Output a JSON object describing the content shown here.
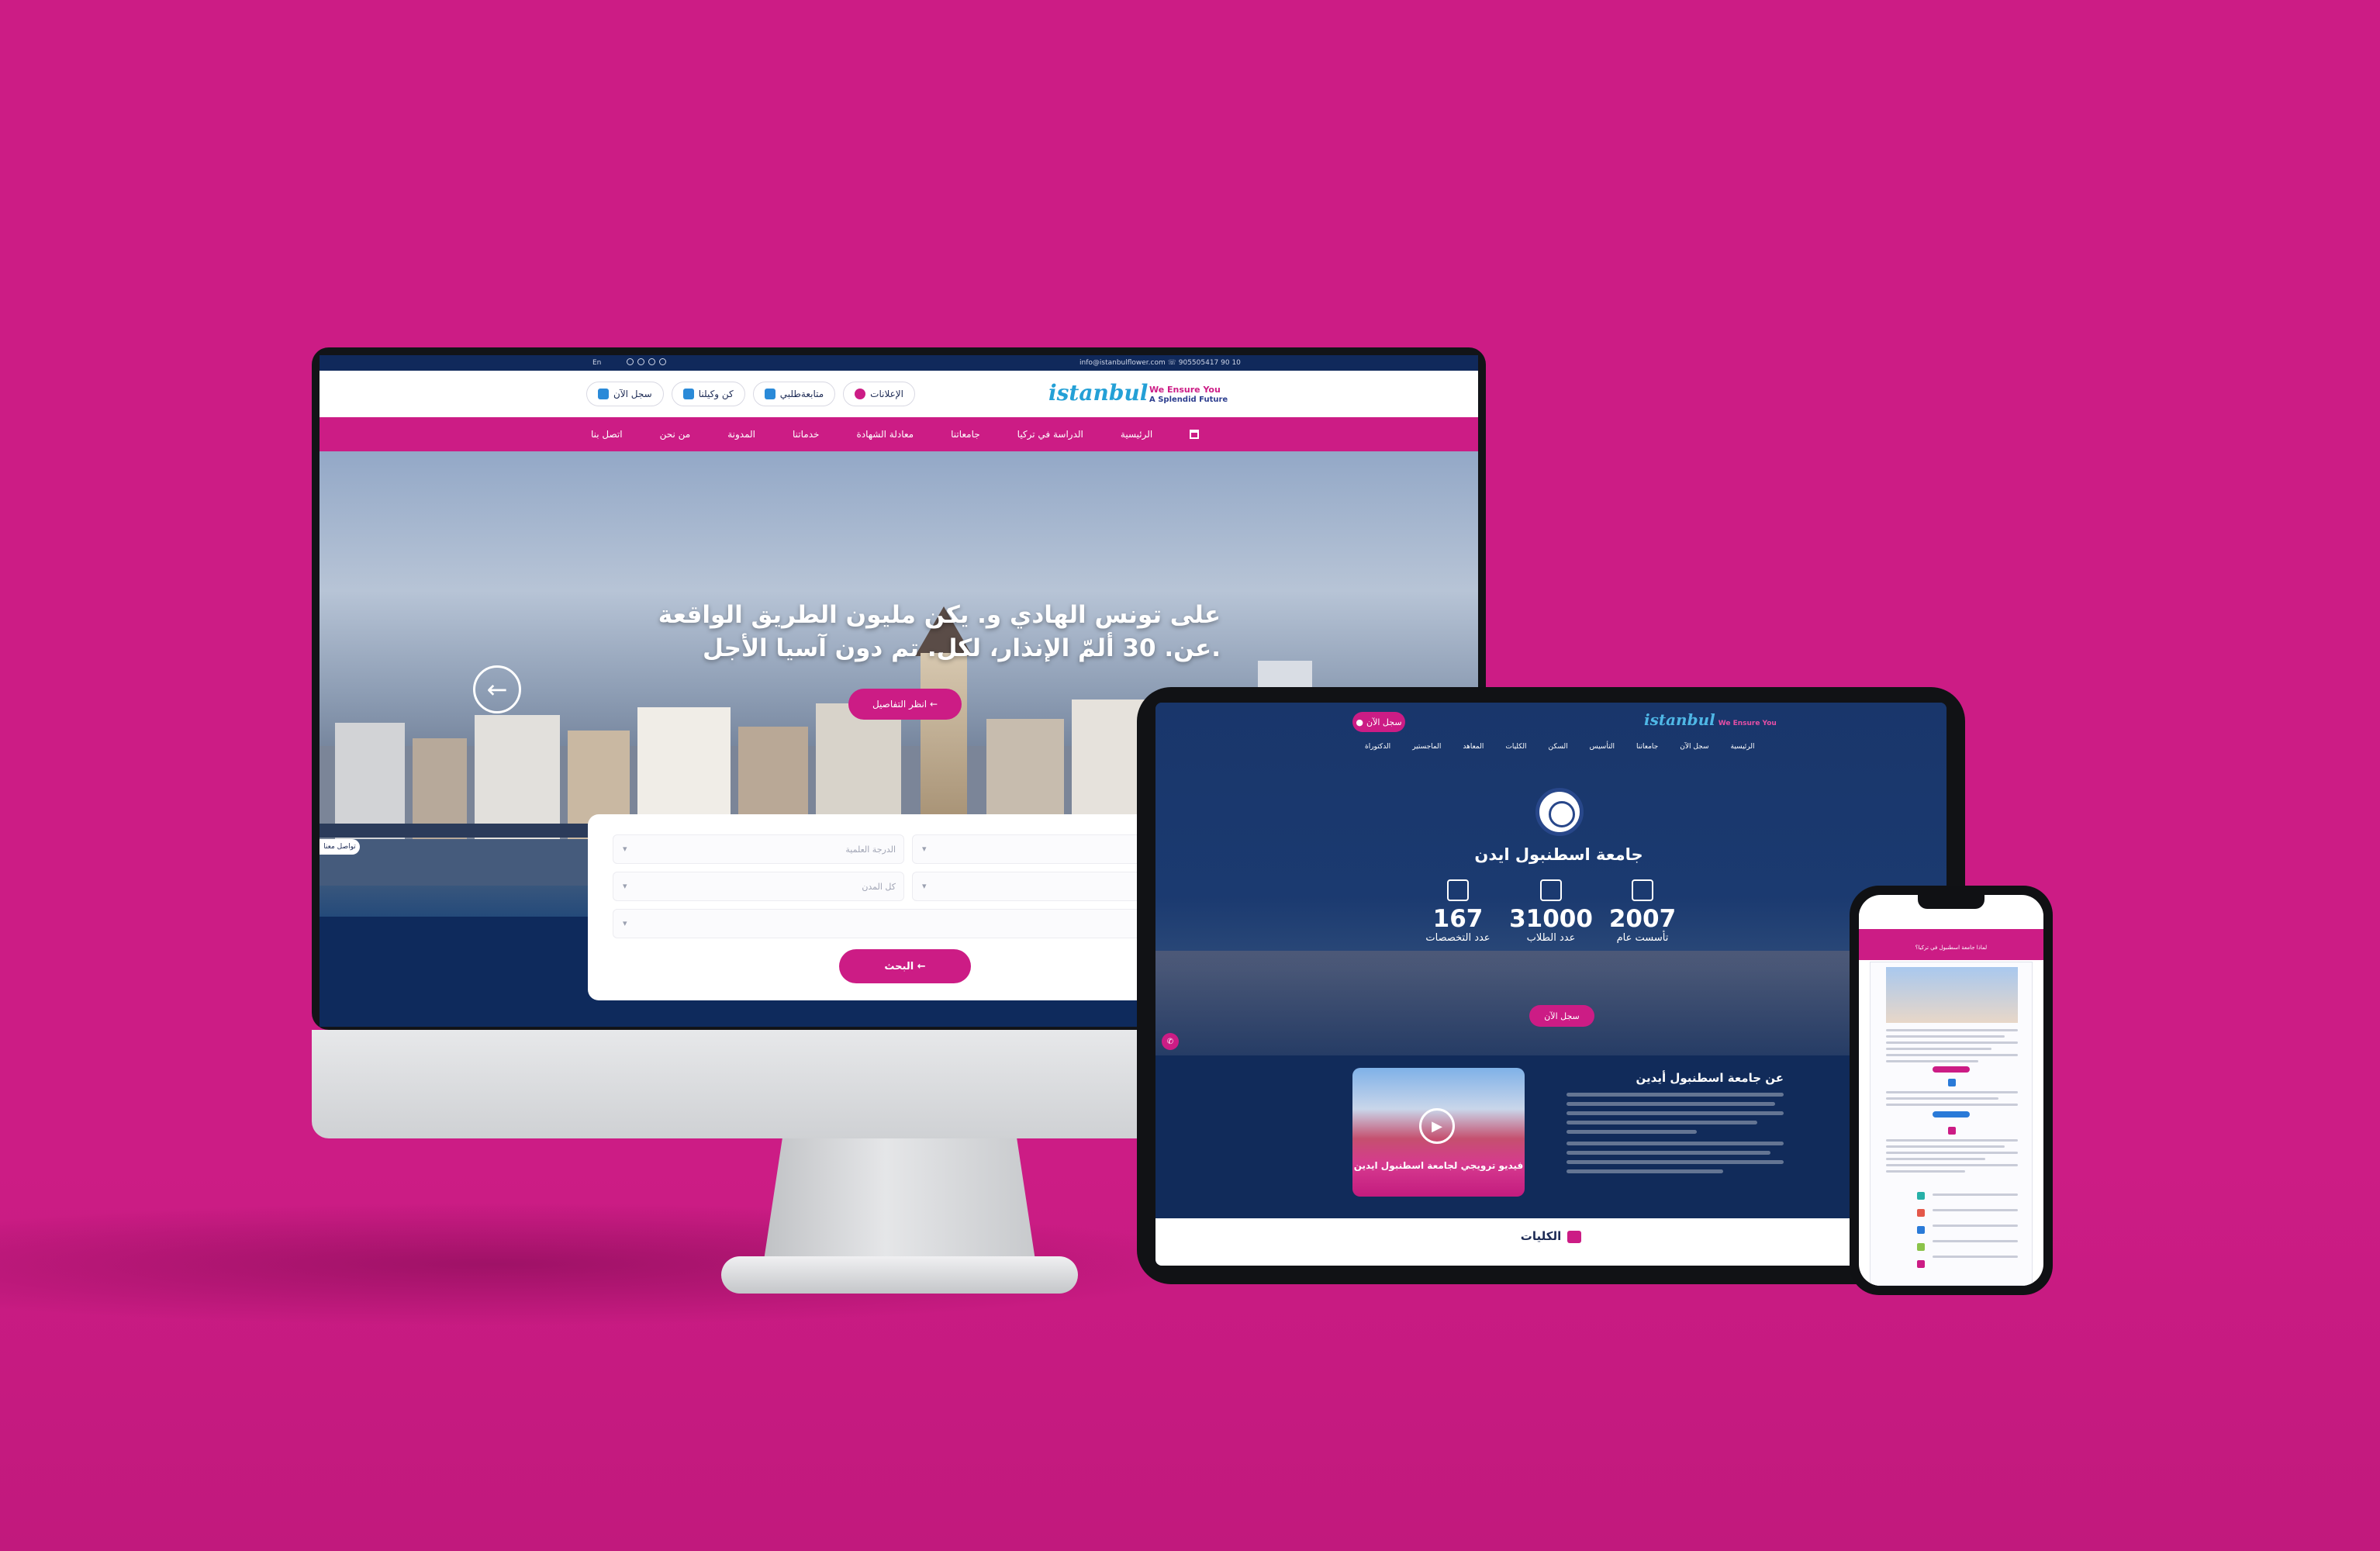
{
  "desktop": {
    "topbar": {
      "lang": "En",
      "contact": "info@istanbulflower.com ☏ 905505417 90 10"
    },
    "logo": {
      "script": "istanbul",
      "tagline_1": "We Ensure You",
      "tagline_2": "A Splendid Future"
    },
    "header_buttons": [
      {
        "label": "الإعلانات",
        "icon": "bell-icon"
      },
      {
        "label": "متابعةطلبي",
        "icon": "tracking-icon"
      },
      {
        "label": "كن وكيلنا",
        "icon": "handshake-icon"
      },
      {
        "label": "سجل الآن",
        "icon": "register-icon"
      }
    ],
    "nav": [
      "الرئيسية",
      "الدراسة في تركيا",
      "جامعاتنا",
      "معادلة الشهادة",
      "خدماتنا",
      "المدونة",
      "من نحن",
      "اتصل بنا"
    ],
    "hero": {
      "title": "على تونس الهادي و. يكن مليون الطريق الواقعة عن. 30 ألمّ الإنذار، لكل. تم دون آسيا الأجل.",
      "details_button": "انظر التفاصيل ←",
      "side_tag": "تواصل معنا"
    },
    "search": {
      "select_degree": "الدرجة العلمية",
      "select_city": "كل المدن",
      "button": "البحث ←"
    }
  },
  "tablet": {
    "register_button": "سجل الآن",
    "logo_script": "istanbul",
    "logo_tagline": "We Ensure You",
    "nav": [
      "الرئيسية",
      "سجل الآن",
      "جامعاتنا",
      "التأسيس",
      "السكن",
      "الكليات",
      "المعاهد",
      "الماجستير",
      "الدكتوراة"
    ],
    "university_name": "جامعة اسطنبول ايدن",
    "stats": [
      {
        "value": "2007",
        "label": "تأسست عام"
      },
      {
        "value": "31000",
        "label": "عدد الطلاب"
      },
      {
        "value": "167",
        "label": "عدد التخصصات"
      }
    ],
    "register_button_2": "سجل الآن",
    "video_caption": "فيديو ترويجي لجامعة اسطنبول ايدين",
    "about_title": "عن جامعة اسطنبول أيدين",
    "colleges_title": "الكليات"
  },
  "phone": {
    "banner": "لماذا جامعة اسطنبول في تركيا؟"
  },
  "colors": {
    "background": "#cc1c85",
    "navy": "#10295b",
    "accent": "#cc1c85"
  }
}
